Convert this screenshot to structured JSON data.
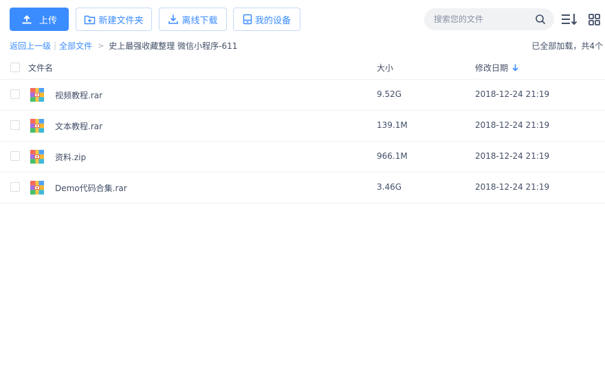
{
  "toolbar": {
    "upload_label": "上传",
    "new_folder_label": "新建文件夹",
    "offline_download_label": "离线下载",
    "my_devices_label": "我的设备"
  },
  "search": {
    "placeholder": "搜索您的文件"
  },
  "breadcrumb": {
    "back_label": "返回上一级",
    "separator": "|",
    "root_label": "全部文件",
    "arrow": ">",
    "current_label": "史上最强收藏整理 微信小程序-611"
  },
  "load_status": "已全部加载，共4个",
  "table": {
    "columns": {
      "name": "文件名",
      "size": "大小",
      "date": "修改日期"
    },
    "rows": [
      {
        "name": "视频教程.rar",
        "size": "9.52G",
        "date": "2018-12-24 21:19",
        "icon": "archive-icon"
      },
      {
        "name": "文本教程.rar",
        "size": "139.1M",
        "date": "2018-12-24 21:19",
        "icon": "archive-icon"
      },
      {
        "name": "资料.zip",
        "size": "966.1M",
        "date": "2018-12-24 21:19",
        "icon": "archive-icon"
      },
      {
        "name": "Demo代码合集.rar",
        "size": "3.46G",
        "date": "2018-12-24 21:19",
        "icon": "archive-icon"
      }
    ]
  },
  "colors": {
    "accent": "#3b8cff",
    "text": "#424e67",
    "border": "#eef0f4",
    "search_bg": "#f1f2f4"
  }
}
